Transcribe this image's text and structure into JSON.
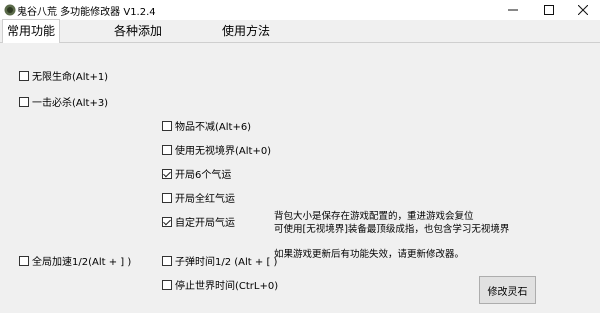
{
  "window": {
    "title": "鬼谷八荒 多功能修改器  V1.2.4",
    "icon": "ghost-app-icon"
  },
  "tabs": [
    {
      "label": "常用功能",
      "active": true
    },
    {
      "label": "各种添加",
      "active": false
    },
    {
      "label": "使用方法",
      "active": false
    }
  ],
  "options": {
    "infinite_life": {
      "label": "无限生命(Alt+1)",
      "checked": false
    },
    "one_hit_kill": {
      "label": "一击必杀(Alt+3)",
      "checked": false
    },
    "items_no_decrease": {
      "label": "物品不减(Alt+6)",
      "checked": false
    },
    "ignore_realm": {
      "label": "使用无视境界(Alt+0)",
      "checked": false
    },
    "start_six_luck": {
      "label": "开局6个气运",
      "checked": true
    },
    "start_all_red_luck": {
      "label": "开局全红气运",
      "checked": false
    },
    "custom_start_luck": {
      "label": "自定开局气运",
      "checked": true
    },
    "global_speed": {
      "label": "全局加速1/2(Alt + ] )",
      "checked": false
    },
    "bullet_time": {
      "label": "子弹时间1/2 (Alt + [ )",
      "checked": false
    },
    "stop_world_time": {
      "label": "停止世界时间(CtrL+0)",
      "checked": false
    }
  },
  "info": {
    "line1": "背包大小是保存在游戏配置的，重进游戏会复位",
    "line2": "可使用[无视境界]装备最顶级成指，也包含学习无视境界",
    "line3": "如果游戏更新后有功能失效，请更新修改器。"
  },
  "buttons": {
    "modify_spirit_stone": "修改灵石"
  }
}
